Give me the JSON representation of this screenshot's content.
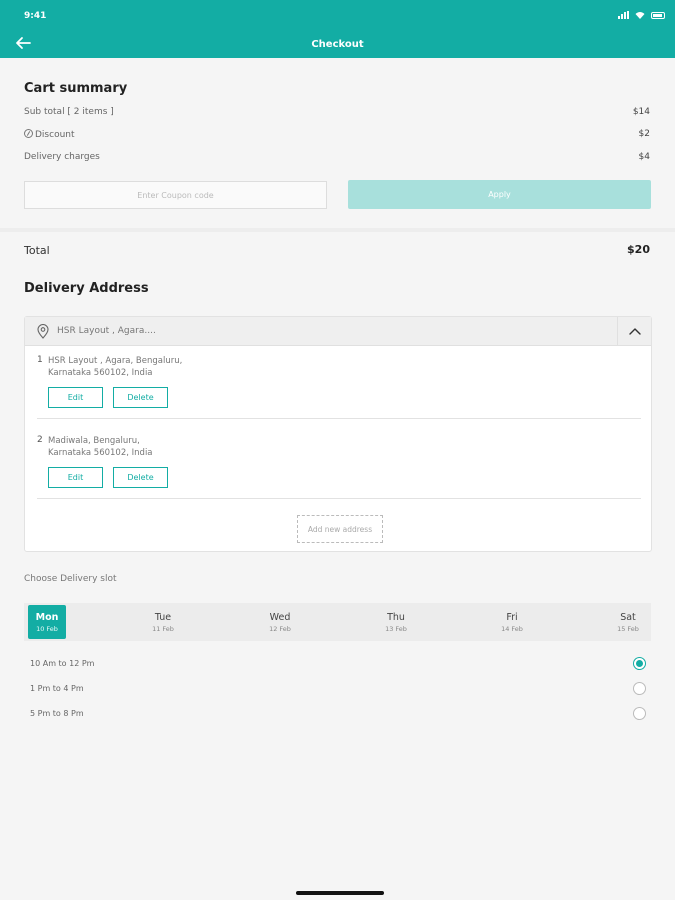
{
  "status_bar": {
    "time": "9:41"
  },
  "nav": {
    "title": "Checkout",
    "back_icon": "arrow-left-icon"
  },
  "cart_summary": {
    "title": "Cart summary",
    "subtotal_label": "Sub total [ 2 items ]",
    "subtotal_value": "$14",
    "discount_label": "Discount",
    "discount_value": "$2",
    "delivery_label": "Delivery charges",
    "delivery_value": "$4",
    "coupon_placeholder": "Enter Coupon code",
    "apply_label": "Apply"
  },
  "total": {
    "label": "Total",
    "value": "$20"
  },
  "delivery_address": {
    "title": "Delivery Address",
    "selected": "HSR Layout , Agara....",
    "addresses": [
      {
        "num": "1",
        "text": "HSR Layout , Agara, Bengaluru,\nKarnataka 560102, India"
      },
      {
        "num": "2",
        "text": "Madiwala, Bengaluru,\nKarnataka 560102, India"
      }
    ],
    "edit_label": "Edit",
    "delete_label": "Delete",
    "add_new_label": "Add new address"
  },
  "delivery_slot": {
    "heading": "Choose Delivery slot",
    "days": [
      {
        "name": "Mon",
        "date": "10 Feb",
        "active": true
      },
      {
        "name": "Tue",
        "date": "11 Feb"
      },
      {
        "name": "Wed",
        "date": "12 Feb"
      },
      {
        "name": "Thu",
        "date": "13 Feb"
      },
      {
        "name": "Fri",
        "date": "14 Feb"
      },
      {
        "name": "Sat",
        "date": "15 Feb"
      }
    ],
    "slots": [
      {
        "label": "10 Am to 12 Pm",
        "selected": true
      },
      {
        "label": "1 Pm to 4 Pm",
        "selected": false
      },
      {
        "label": "5 Pm to 8 Pm",
        "selected": false
      }
    ]
  },
  "colors": {
    "accent": "#13ada4",
    "accent_light": "#a8e0dc",
    "background": "#f5f5f5"
  }
}
